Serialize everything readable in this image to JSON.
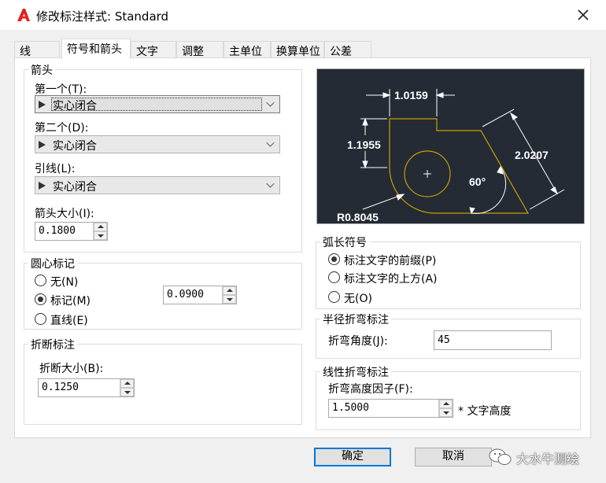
{
  "window": {
    "title": "修改标注样式: Standard",
    "app_icon": "autocad-a-icon",
    "close_icon": "close-icon"
  },
  "tabs": [
    {
      "label": "线",
      "active": false
    },
    {
      "label": "符号和箭头",
      "active": true
    },
    {
      "label": "文字",
      "active": false
    },
    {
      "label": "调整",
      "active": false
    },
    {
      "label": "主单位",
      "active": false
    },
    {
      "label": "换算单位",
      "active": false
    },
    {
      "label": "公差",
      "active": false
    }
  ],
  "arrowheads": {
    "title": "箭头",
    "first_label": "第一个(T):",
    "first_value": "实心闭合",
    "second_label": "第二个(D):",
    "second_value": "实心闭合",
    "leader_label": "引线(L):",
    "leader_value": "实心闭合",
    "size_label": "箭头大小(I):",
    "size_value": "0.1800"
  },
  "center_marks": {
    "title": "圆心标记",
    "options": [
      {
        "label": "无(N)",
        "checked": false
      },
      {
        "label": "标记(M)",
        "checked": true
      },
      {
        "label": "直线(E)",
        "checked": false
      }
    ],
    "size_value": "0.0900"
  },
  "break": {
    "title": "折断标注",
    "size_label": "折断大小(B):",
    "size_value": "0.1250"
  },
  "arc_length": {
    "title": "弧长符号",
    "options": [
      {
        "label": "标注文字的前缀(P)",
        "checked": true
      },
      {
        "label": "标注文字的上方(A)",
        "checked": false
      },
      {
        "label": "无(O)",
        "checked": false
      }
    ]
  },
  "radius_jog": {
    "title": "半径折弯标注",
    "angle_label": "折弯角度(J):",
    "angle_value": "45"
  },
  "linear_jog": {
    "title": "线性折弯标注",
    "height_label": "折弯高度因子(F):",
    "height_value": "1.5000",
    "suffix": "* 文字高度"
  },
  "preview": {
    "dim_top": "1.0159",
    "dim_left": "1.1955",
    "dim_diag": "2.0207",
    "dim_angle": "60°",
    "dim_radius": "R0.8045",
    "colors": {
      "background": "#242b35",
      "geometry": "#c8a000",
      "dimension": "#ffffff"
    }
  },
  "buttons": {
    "ok": "确定",
    "cancel": "取消"
  },
  "watermark": {
    "text": "大水牛测绘"
  }
}
